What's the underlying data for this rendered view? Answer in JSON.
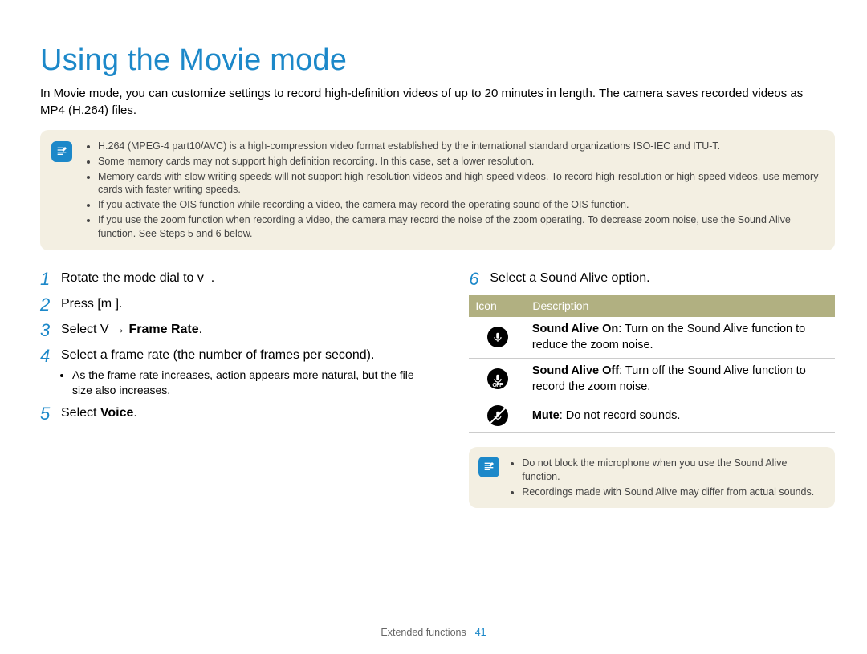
{
  "title": "Using the Movie mode",
  "intro": "In Movie mode, you can customize settings to record high-definition videos of up to 20 minutes in length. The camera saves recorded videos as MP4 (H.264) files.",
  "notes": [
    "H.264 (MPEG-4 part10/AVC) is a high-compression video format established by the international standard organizations ISO-IEC and ITU-T.",
    "Some memory cards may not support high definition recording. In this case, set a lower resolution.",
    "Memory cards with slow writing speeds will not support high-resolution videos and high-speed videos. To record high-resolution or high-speed videos, use memory cards with faster writing speeds.",
    "If you activate the OIS function while recording a video, the camera may record the operating sound of the OIS function.",
    "If you use the zoom function when recording a video, the camera may record the noise of the zoom operating. To decrease zoom noise, use the Sound Alive function. See Steps 5 and 6 below."
  ],
  "steps": {
    "1": {
      "prefix": "Rotate the mode dial to ",
      "glyph": "v",
      "suffix": "."
    },
    "2": {
      "prefix": "Press [",
      "glyph": "m",
      "suffix_gap": "       ",
      "suffix": "]."
    },
    "3": {
      "prefix": "Select ",
      "g1": "V",
      "gap": "   ",
      "arrow": "→ ",
      "bold": "Frame Rate",
      "suffix": "."
    },
    "4": {
      "text": "Select a frame rate (the number of frames per second).",
      "sub": "As the frame rate increases, action appears more natural, but the file size also increases."
    },
    "5": {
      "prefix": "Select ",
      "bold": "Voice",
      "suffix": "."
    },
    "6": {
      "text": "Select a Sound Alive option."
    }
  },
  "table": {
    "h1": "Icon",
    "h2": "Description",
    "rows": [
      {
        "bold": "Sound Alive On",
        "rest": ": Turn on the Sound Alive function to reduce the zoom noise."
      },
      {
        "bold": "Sound Alive Off",
        "rest": ": Turn off the Sound Alive function to record the zoom noise."
      },
      {
        "bold": "Mute",
        "rest": ": Do not record sounds."
      }
    ]
  },
  "small_notes": [
    "Do not block the microphone when you use the Sound Alive function.",
    "Recordings made with Sound Alive may differ from actual sounds."
  ],
  "footer": {
    "section": "Extended functions",
    "page": "41"
  }
}
